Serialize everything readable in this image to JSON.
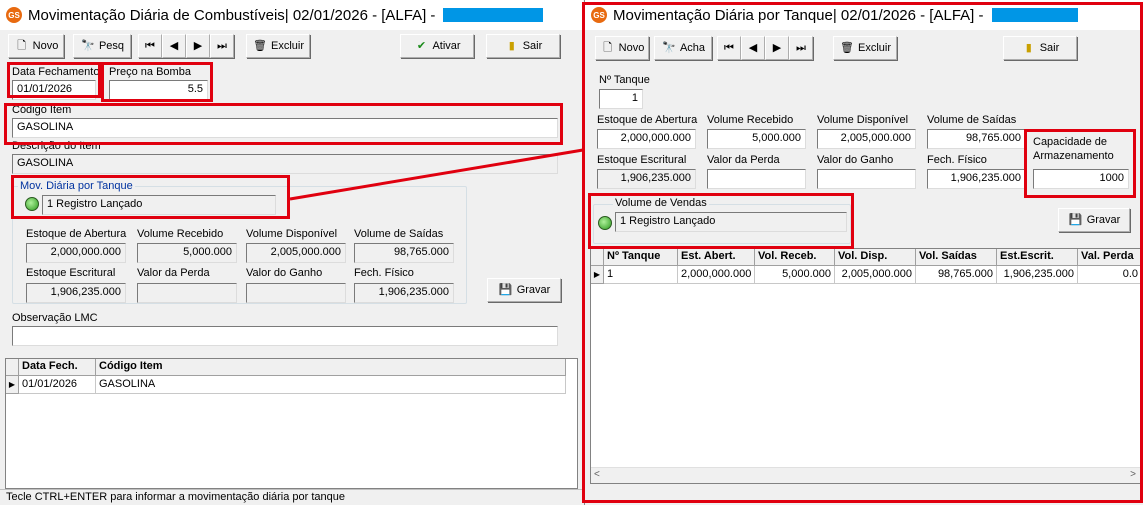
{
  "left_window": {
    "title": "Movimentação Diária de Combustíveis|  02/01/2026 - [ALFA] -",
    "toolbar": {
      "novo": "Novo",
      "pesq": "Pesq",
      "excluir": "Excluir",
      "ativar": "Ativar",
      "sair": "Sair"
    },
    "form": {
      "data_fechamento_label": "Data Fechamento",
      "data_fechamento_value": "01/01/2026",
      "preco_bomba_label": "Preço na Bomba",
      "preco_bomba_value": "5.5",
      "codigo_item_label": "Código Item",
      "codigo_item_value": "GASOLINA",
      "descricao_item_label": "Descrição do Item",
      "descricao_item_value": "GASOLINA",
      "mov_group_label": "Mov. Diária por Tanque",
      "mov_status": "1 Registro Lançado",
      "estoque_abertura_label": "Estoque de Abertura",
      "estoque_abertura_value": "2,000,000.000",
      "volume_recebido_label": "Volume Recebido",
      "volume_recebido_value": "5,000.000",
      "volume_disponivel_label": "Volume Disponível",
      "volume_disponivel_value": "2,005,000.000",
      "volume_saidas_label": "Volume de Saídas",
      "volume_saidas_value": "98,765.000",
      "estoque_escritural_label": "Estoque Escritural",
      "estoque_escritural_value": "1,906,235.000",
      "valor_perda_label": "Valor da Perda",
      "valor_perda_value": "",
      "valor_ganho_label": "Valor do Ganho",
      "valor_ganho_value": "",
      "fech_fisico_label": "Fech. Físico",
      "fech_fisico_value": "1,906,235.000",
      "gravar": "Gravar",
      "observacao_label": "Observação LMC",
      "observacao_value": ""
    },
    "grid": {
      "headers": [
        "Data Fech.",
        "Código Item"
      ],
      "rows": [
        [
          "01/01/2026",
          "GASOLINA"
        ]
      ]
    },
    "status_bar": "Tecle CTRL+ENTER para informar a movimentação diária por tanque"
  },
  "right_window": {
    "title": "Movimentação Diária por Tanque|  02/01/2026 - [ALFA] -",
    "toolbar": {
      "novo": "Novo",
      "acha": "Acha",
      "excluir": "Excluir",
      "sair": "Sair"
    },
    "form": {
      "tanque_label": "Nº Tanque",
      "tanque_value": "1",
      "estoque_abertura_label": "Estoque de Abertura",
      "estoque_abertura_value": "2,000,000.000",
      "volume_recebido_label": "Volume Recebido",
      "volume_recebido_value": "5,000.000",
      "volume_disponivel_label": "Volume Disponível",
      "volume_disponivel_value": "2,005,000.000",
      "volume_saidas_label": "Volume de Saídas",
      "volume_saidas_value": "98,765.000",
      "capacidade_label_1": "Capacidade de",
      "capacidade_label_2": "Armazenamento",
      "capacidade_value": "1000",
      "estoque_escritural_label": "Estoque Escritural",
      "estoque_escritural_value": "1,906,235.000",
      "valor_perda_label": "Valor da Perda",
      "valor_perda_value": "",
      "valor_ganho_label": "Valor do Ganho",
      "valor_ganho_value": "",
      "fech_fisico_label": "Fech. Físico",
      "fech_fisico_value": "1,906,235.000",
      "vendas_group_label": "Volume de Vendas",
      "vendas_status": "1 Registro Lançado",
      "gravar": "Gravar"
    },
    "grid": {
      "headers": [
        "Nº Tanque",
        "Est. Abert.",
        "Vol. Receb.",
        "Vol. Disp.",
        "Vol. Saídas",
        "Est.Escrit.",
        "Val. Perda"
      ],
      "rows": [
        [
          "1",
          "2,000,000.000",
          "5,000.000",
          "2,005,000.000",
          "98,765.000",
          "1,906,235.000",
          "0.0"
        ]
      ]
    }
  },
  "colors": {
    "highlight_red": "#e0000f",
    "redaction_blue": "#0096e6",
    "group_label_blue": "#0033a0"
  }
}
